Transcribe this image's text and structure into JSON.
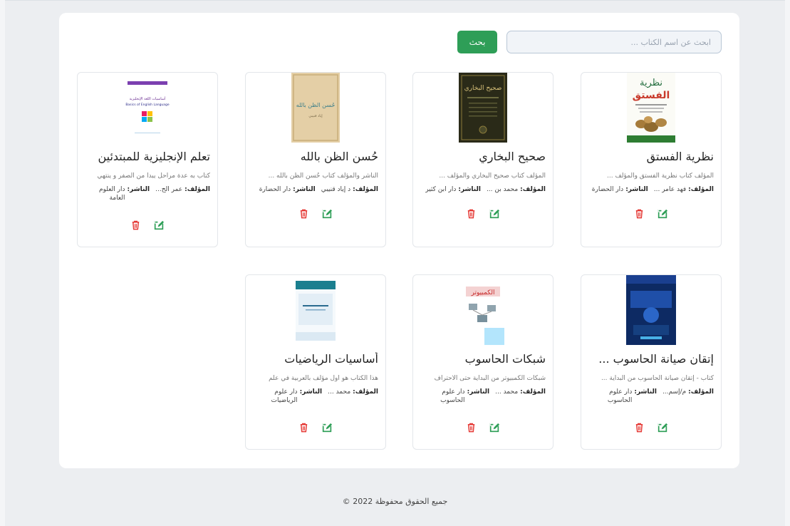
{
  "search": {
    "placeholder": "ابحث عن اسم الكتاب ...",
    "button_label": "بحث"
  },
  "labels": {
    "author": "المؤلف:",
    "publisher": "الناشر:"
  },
  "books": [
    {
      "title": "نظرية الفستق",
      "description": "المؤلف كتاب نظرية الفستق والمؤلف ...",
      "author": "فهد عامر ...",
      "publisher": "دار الحضارة"
    },
    {
      "title": "صحيح البخاري",
      "description": "المؤلف كتاب صحيح البخاري والمؤلف ...",
      "author": "محمد بن ...",
      "publisher": "دار ابن كثير"
    },
    {
      "title": "حُسن الظن بالله",
      "description": "الناشر والمؤلف كتاب حُسن الظن بالله ...",
      "author": "د إياد قنيبي",
      "publisher": "دار الحضارة"
    },
    {
      "title": "تعلم الإنجليزية للمبتدئين",
      "description": "كتاب به عدة مراحل يبدأ من الصفر و ينتهي",
      "author": "عمر الح...",
      "publisher": "دار العلوم العامة"
    },
    {
      "title": "إتقان صيانة الحاسوب ...",
      "description": "كتاب - إتقان صيانة الحاسوب من البداية ...",
      "author": "م/إسم...",
      "publisher": "دار علوم الحاسوب"
    },
    {
      "title": "شبكات الحاسوب",
      "description": "شبكات الكمبيوتر من البداية حتى الاحتراف",
      "author": "محمد ...",
      "publisher": "دار علوم الحاسوب"
    },
    {
      "title": "أساسيات الرياضيات",
      "description": "هذا الكتاب هو أول مؤلف بالعربية في علم",
      "author": "محمد ...",
      "publisher": "دار علوم الرياضيات"
    }
  ],
  "covers": {
    "c0": {
      "top": "نظرية",
      "main": "الفستق"
    },
    "c1": {
      "main": "صحيح البخاري"
    },
    "c2": {
      "main": "حُسن الظن بالله",
      "sub": "إياد قنيبي"
    },
    "c3": {
      "ar": "أساسيات اللغة الإنجليزية",
      "en": "Basics of English Language"
    },
    "c5": {
      "main": "الكمبيوتر"
    }
  },
  "footer": {
    "text": "جميع الحقوق محفوظة 2022 ©"
  },
  "colors": {
    "accent": "#2e9e57",
    "delete": "#e53935",
    "edit": "#2e9e57"
  }
}
